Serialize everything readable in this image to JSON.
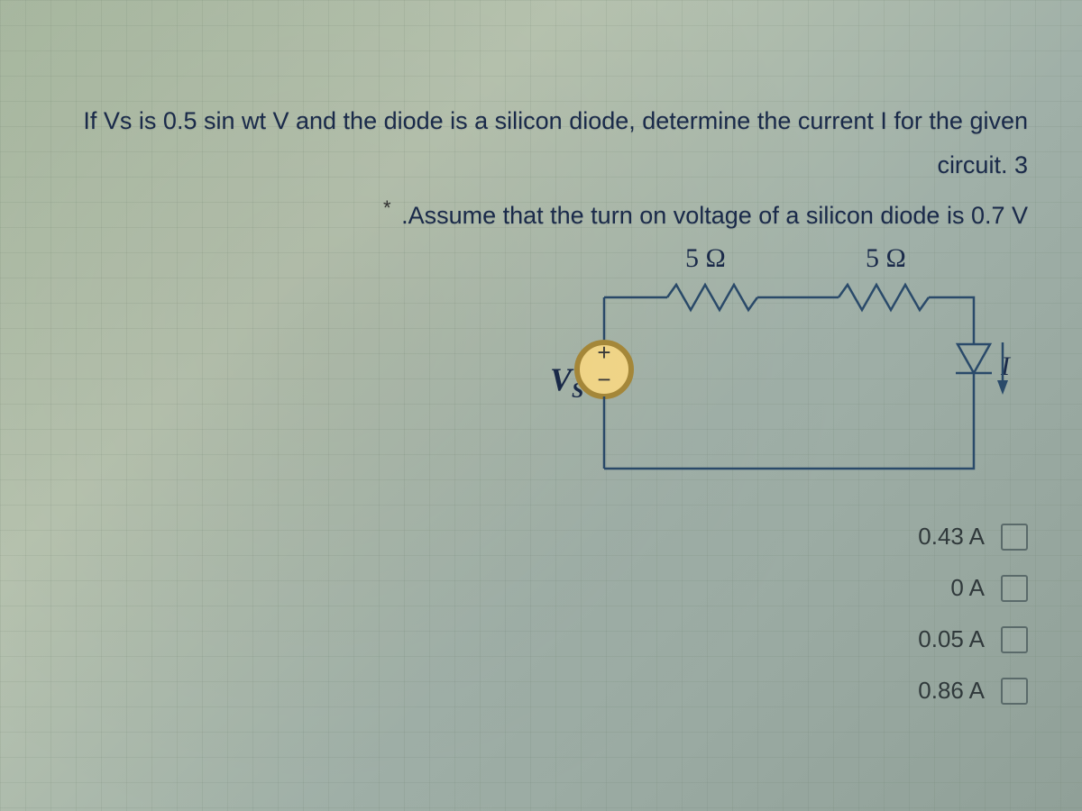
{
  "question": {
    "line1": "If Vs is 0.5 sin wt V and the diode is a silicon diode, determine the current I for the given circuit.",
    "points": "3",
    "assumption": ".Assume that the turn on voltage of a silicon diode is 0.7 V"
  },
  "circuit": {
    "r1": "5 Ω",
    "r2": "5 Ω",
    "source_label": "V",
    "source_sub": "S",
    "current_label": "I"
  },
  "options": [
    {
      "label": "0.43 A"
    },
    {
      "label": "0 A"
    },
    {
      "label": "0.05 A"
    },
    {
      "label": "0.86 A"
    }
  ]
}
